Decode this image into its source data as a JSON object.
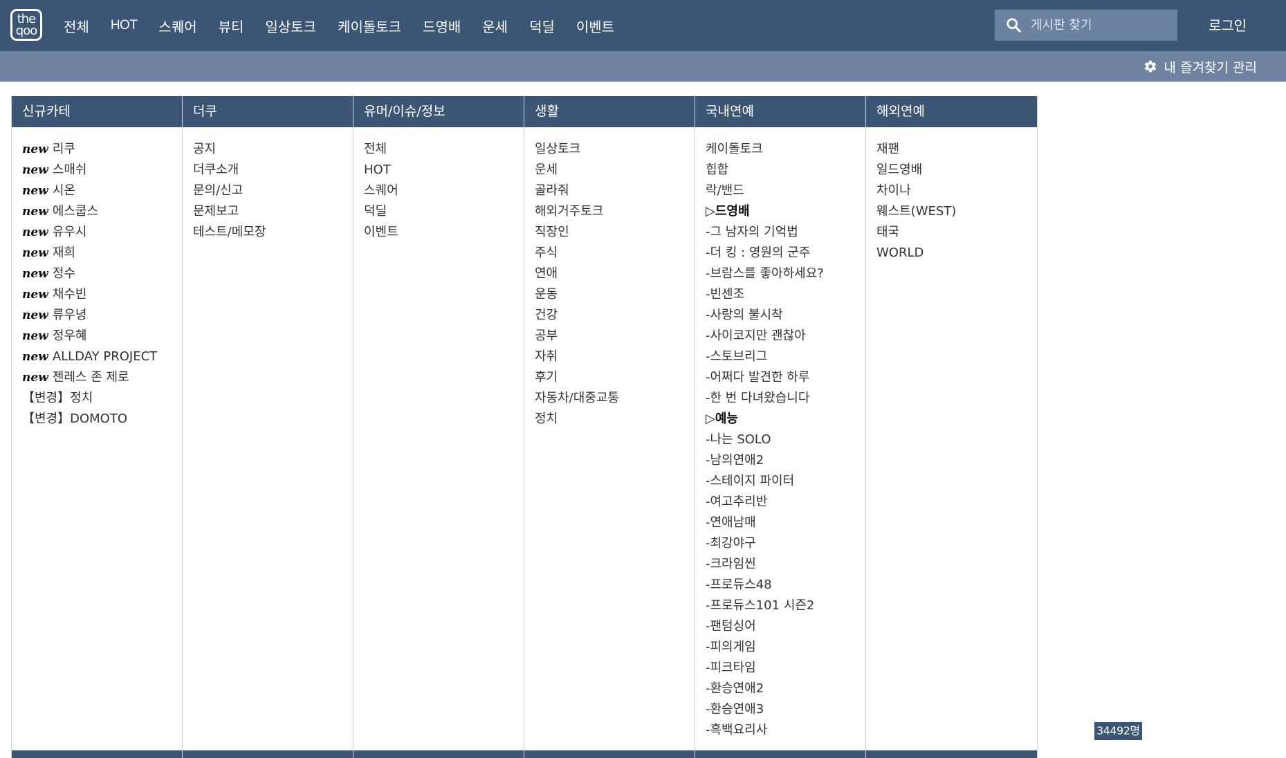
{
  "header": {
    "logo_top": "the",
    "logo_bottom": "qoo",
    "nav": [
      {
        "label": "전체"
      },
      {
        "label": "HOT"
      },
      {
        "label": "스퀘어"
      },
      {
        "label": "뷰티"
      },
      {
        "label": "일상토크"
      },
      {
        "label": "케이돌토크"
      },
      {
        "label": "드영배"
      },
      {
        "label": "운세"
      },
      {
        "label": "덕딜"
      },
      {
        "label": "이벤트"
      }
    ],
    "search_placeholder": "게시판 찾기",
    "login_label": "로그인"
  },
  "subbar": {
    "favorites_label": "내 즐겨찾기 관리"
  },
  "columns": [
    {
      "title": "신규카테",
      "items": [
        {
          "tag": "new",
          "label": "리쿠"
        },
        {
          "tag": "new",
          "label": "스매쉬"
        },
        {
          "tag": "new",
          "label": "시온"
        },
        {
          "tag": "new",
          "label": "에스쿱스"
        },
        {
          "tag": "new",
          "label": "유우시"
        },
        {
          "tag": "new",
          "label": "재희"
        },
        {
          "tag": "new",
          "label": "정수"
        },
        {
          "tag": "new",
          "label": "채수빈"
        },
        {
          "tag": "new",
          "label": "류우녕"
        },
        {
          "tag": "new",
          "label": "정우혜"
        },
        {
          "tag": "new",
          "label": "ALLDAY PROJECT"
        },
        {
          "tag": "new",
          "label": "젠레스 존 제로"
        },
        {
          "tag": "",
          "label": "【변경】정치"
        },
        {
          "tag": "",
          "label": "【변경】DOMOTO"
        }
      ]
    },
    {
      "title": "더쿠",
      "items": [
        {
          "label": "공지"
        },
        {
          "label": "더쿠소개"
        },
        {
          "label": "문의/신고"
        },
        {
          "label": "문제보고"
        },
        {
          "label": "테스트/메모장"
        }
      ]
    },
    {
      "title": "유머/이슈/정보",
      "items": [
        {
          "label": "전체"
        },
        {
          "label": "HOT"
        },
        {
          "label": "스퀘어"
        },
        {
          "label": "덕딜"
        },
        {
          "label": "이벤트"
        }
      ]
    },
    {
      "title": "생활",
      "items": [
        {
          "label": "일상토크"
        },
        {
          "label": "운세"
        },
        {
          "label": "골라줘"
        },
        {
          "label": "해외거주토크"
        },
        {
          "label": "직장인"
        },
        {
          "label": "주식"
        },
        {
          "label": "연애"
        },
        {
          "label": "운동"
        },
        {
          "label": "건강"
        },
        {
          "label": "공부"
        },
        {
          "label": "자취"
        },
        {
          "label": "후기"
        },
        {
          "label": "자동차/대중교통"
        },
        {
          "label": "정치"
        }
      ]
    },
    {
      "title": "국내연예",
      "items": [
        {
          "label": "케이돌토크",
          "section": false
        },
        {
          "label": "힙합",
          "section": false
        },
        {
          "label": "락/밴드",
          "section": false
        },
        {
          "label": "▷드영배",
          "section": true
        },
        {
          "label": "-그 남자의 기억법",
          "section": false
        },
        {
          "label": "-더 킹 : 영원의 군주",
          "section": false
        },
        {
          "label": "-브람스를 좋아하세요?",
          "section": false
        },
        {
          "label": "-빈센조",
          "section": false
        },
        {
          "label": "-사랑의 불시착",
          "section": false
        },
        {
          "label": "-사이코지만 괜찮아",
          "section": false
        },
        {
          "label": "-스토브리그",
          "section": false
        },
        {
          "label": "-어쩌다 발견한 하루",
          "section": false
        },
        {
          "label": "-한 번 다녀왔습니다",
          "section": false
        },
        {
          "label": "▷예능",
          "section": true
        },
        {
          "label": "-나는 SOLO",
          "section": false
        },
        {
          "label": "-남의연애2",
          "section": false
        },
        {
          "label": "-스테이지 파이터",
          "section": false
        },
        {
          "label": "-여고추리반",
          "section": false
        },
        {
          "label": "-연애남매",
          "section": false
        },
        {
          "label": "-최강야구",
          "section": false
        },
        {
          "label": "-크라임씬",
          "section": false
        },
        {
          "label": "-프로듀스48",
          "section": false
        },
        {
          "label": "-프로듀스101 시즌2",
          "section": false
        },
        {
          "label": "-팬텀싱어",
          "section": false
        },
        {
          "label": "-피의게임",
          "section": false
        },
        {
          "label": "-피크타임",
          "section": false
        },
        {
          "label": "-환승연애2",
          "section": false
        },
        {
          "label": "-환승연애3",
          "section": false
        },
        {
          "label": "-흑백요리사",
          "section": false
        }
      ]
    },
    {
      "title": "해외연예",
      "items": [
        {
          "label": "재팬"
        },
        {
          "label": "일드영배"
        },
        {
          "label": "차이나"
        },
        {
          "label": "웨스트(WEST)"
        },
        {
          "label": "태국"
        },
        {
          "label": "WORLD"
        }
      ]
    }
  ],
  "visitor_counter": "34492명",
  "colors": {
    "header_bg": "#3b5575",
    "subbar_bg": "#6f82a0",
    "search_bg": "#6b82a0",
    "border": "#c9d0da"
  },
  "icons": {
    "search": "search-icon",
    "favorites": "gear-icon"
  }
}
